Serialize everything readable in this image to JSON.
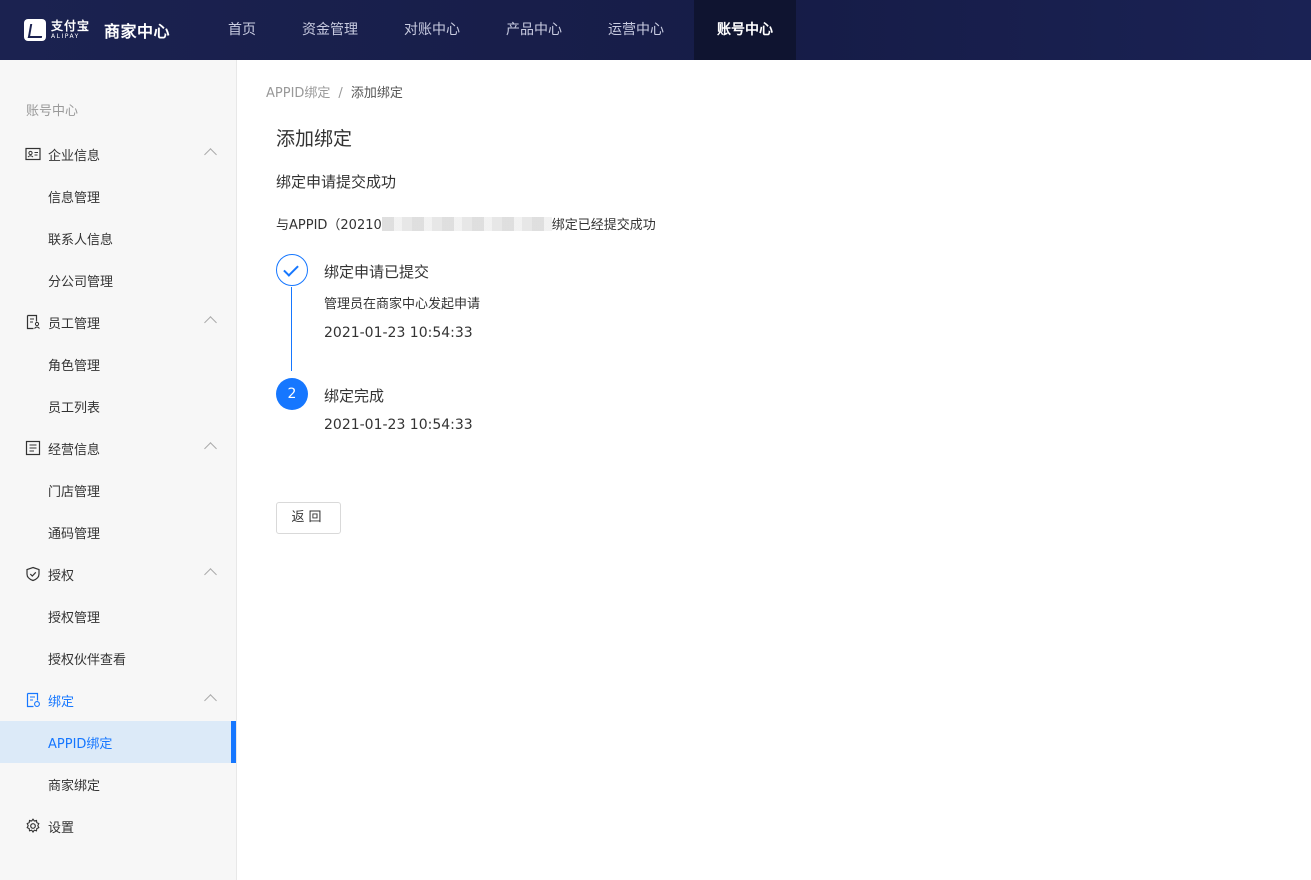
{
  "brand": {
    "logo_cn": "支付宝",
    "logo_en": "ALIPAY",
    "title": "商家中心"
  },
  "nav": [
    {
      "label": "首页"
    },
    {
      "label": "资金管理"
    },
    {
      "label": "对账中心"
    },
    {
      "label": "产品中心"
    },
    {
      "label": "运营中心"
    },
    {
      "label": "账号中心",
      "active": true
    }
  ],
  "sidebar": {
    "title": "账号中心",
    "groups": [
      {
        "label": "企业信息",
        "icon": "id-card-icon",
        "items": [
          "信息管理",
          "联系人信息",
          "分公司管理"
        ]
      },
      {
        "label": "员工管理",
        "icon": "employee-doc-icon",
        "items": [
          "角色管理",
          "员工列表"
        ]
      },
      {
        "label": "经营信息",
        "icon": "list-doc-icon",
        "items": [
          "门店管理",
          "通码管理"
        ]
      },
      {
        "label": "授权",
        "icon": "shield-check-icon",
        "items": [
          "授权管理",
          "授权伙伴查看"
        ]
      },
      {
        "label": "绑定",
        "icon": "bind-doc-icon",
        "items": [
          "APPID绑定",
          "商家绑定"
        ],
        "active_item": "APPID绑定"
      },
      {
        "label": "设置",
        "icon": "gear-icon",
        "items": []
      }
    ]
  },
  "breadcrumb": {
    "parent": "APPID绑定",
    "separator": "/",
    "current": "添加绑定"
  },
  "page": {
    "title": "添加绑定",
    "subtitle": "绑定申请提交成功",
    "desc_prefix": "与APPID（20210",
    "desc_suffix": "绑定已经提交成功"
  },
  "steps": [
    {
      "number": "1",
      "title": "绑定申请已提交",
      "text": "管理员在商家中心发起申请",
      "time": "2021-01-23 10:54:33",
      "status": "done"
    },
    {
      "number": "2",
      "title": "绑定完成",
      "time": "2021-01-23 10:54:33",
      "status": "current"
    }
  ],
  "actions": {
    "back_label": "返回"
  },
  "colors": {
    "topbar": "#1b2250",
    "accent": "#1677ff",
    "sidebar_bg": "#f7f7f7",
    "active_bg": "#dceaf8"
  }
}
